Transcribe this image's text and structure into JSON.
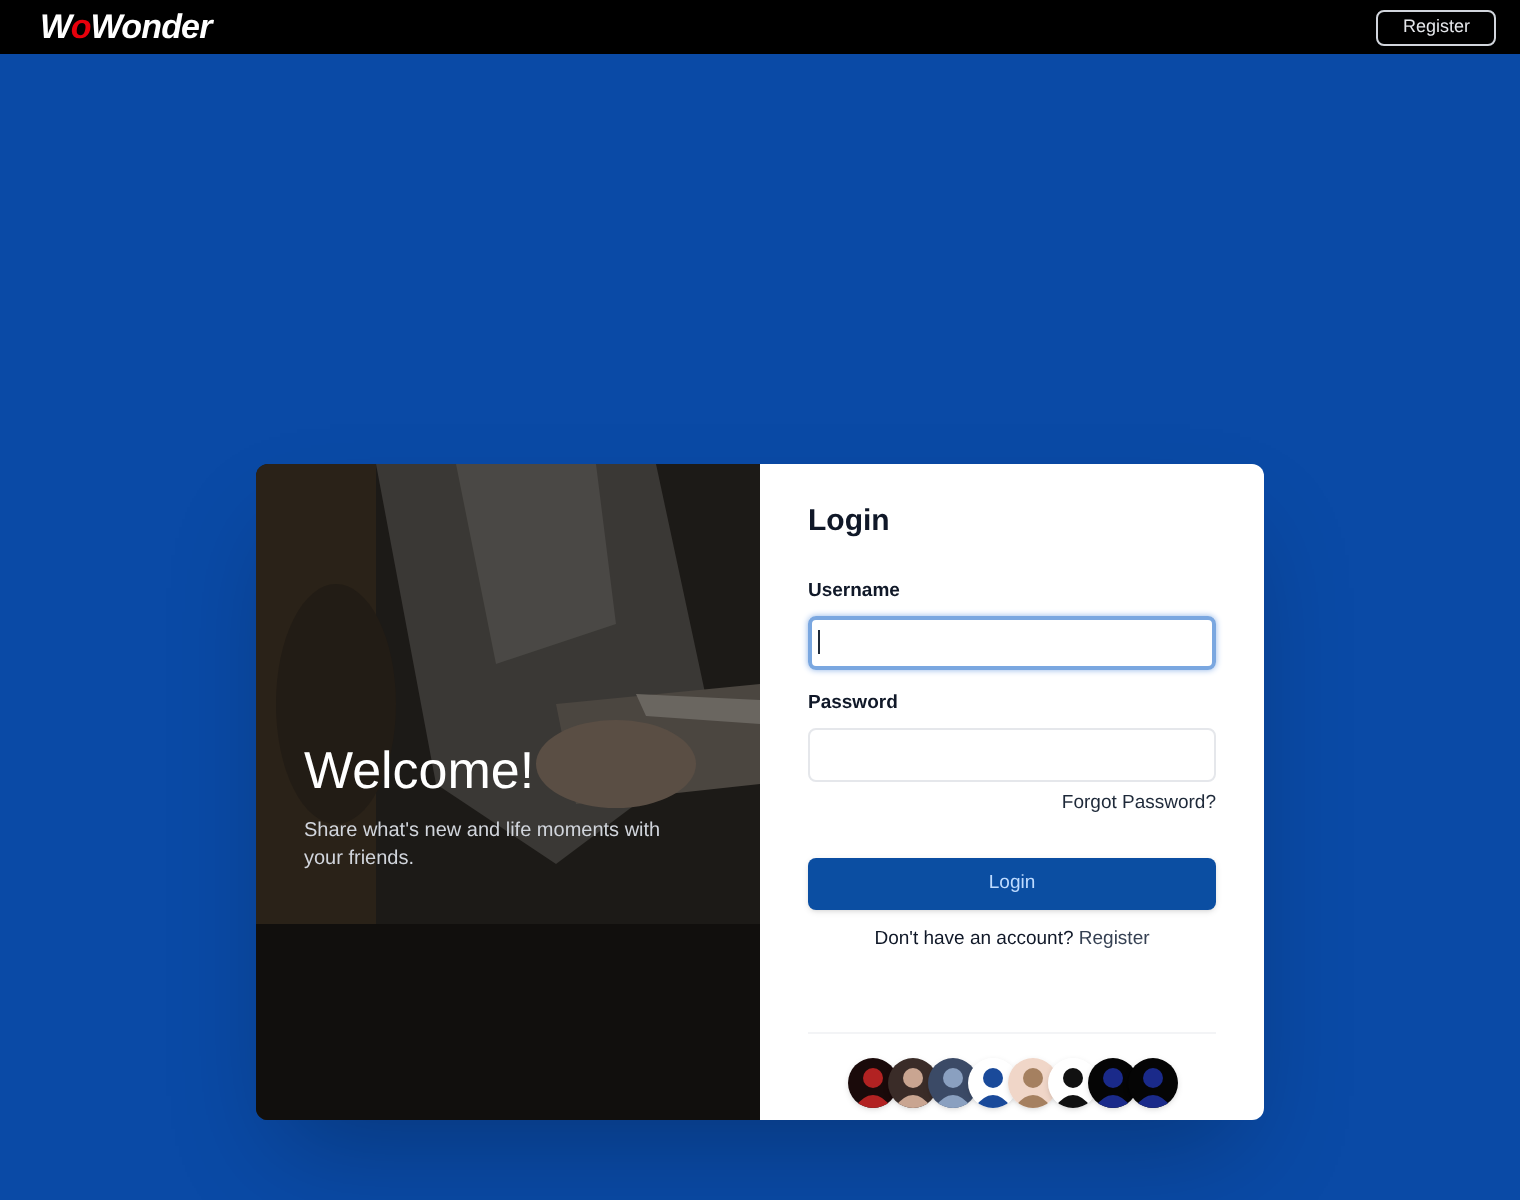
{
  "header": {
    "logo": "WoWonder",
    "register_button": "Register"
  },
  "welcome": {
    "title": "Welcome!",
    "subtitle": "Share what's new and life moments with your friends."
  },
  "login": {
    "title": "Login",
    "fields": [
      {
        "label": "Username",
        "focused": true
      },
      {
        "label": "Password",
        "focused": false
      }
    ],
    "forgot_link": "Forgot Password?",
    "submit_button": "Login",
    "signup_prompt": "Don't have an account?",
    "signup_link": "Register"
  }
}
